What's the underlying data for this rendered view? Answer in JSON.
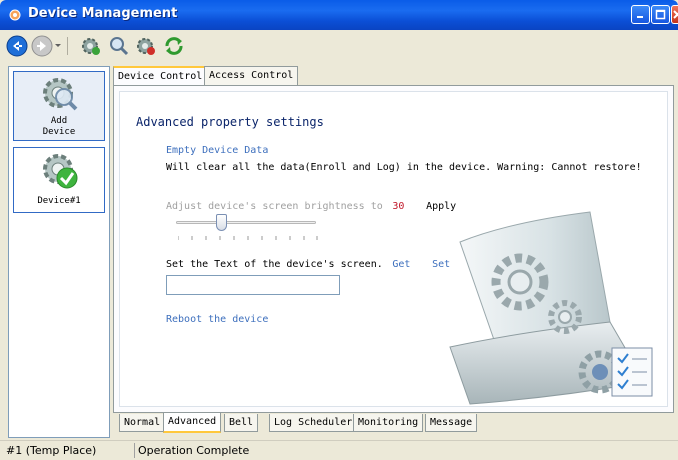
{
  "window": {
    "title": "Device Management"
  },
  "toolbar": {
    "buttons": [
      "back-icon",
      "forward-icon",
      "gear-add-icon",
      "search-icon",
      "gear-remove-icon",
      "refresh-icon"
    ]
  },
  "devices": {
    "add_label_1": "Add",
    "add_label_2": "Device",
    "device1_label": "Device#1"
  },
  "tabs": {
    "top": [
      "Device Control",
      "Access Control"
    ],
    "bottom": [
      "Normal",
      "Advanced",
      "Bell",
      "Log Scheduler",
      "Monitoring",
      "Message"
    ],
    "active_top": "Device Control",
    "active_bottom": "Advanced"
  },
  "content": {
    "section_title": "Advanced property settings",
    "empty_data_link": "Empty Device Data",
    "warning_text": "Will clear all the data(Enroll and Log) in the device. Warning: Cannot restore!",
    "brightness_label": "Adjust device's screen brightness to",
    "brightness_value": "30",
    "apply_link": "Apply",
    "screen_text_label": "Set the Text of the device's screen.",
    "get_link": "Get",
    "set_link": "Set",
    "screen_text_value": "",
    "reboot_link": "Reboot the device"
  },
  "status": {
    "left": "#1 (Temp Place)",
    "right": "Operation Complete"
  },
  "colors": {
    "title_bar": "#0a5ce8",
    "link": "#3d6fbd",
    "brightness_value": "#c0182a",
    "active_tab_accent": "#ffc83c"
  }
}
